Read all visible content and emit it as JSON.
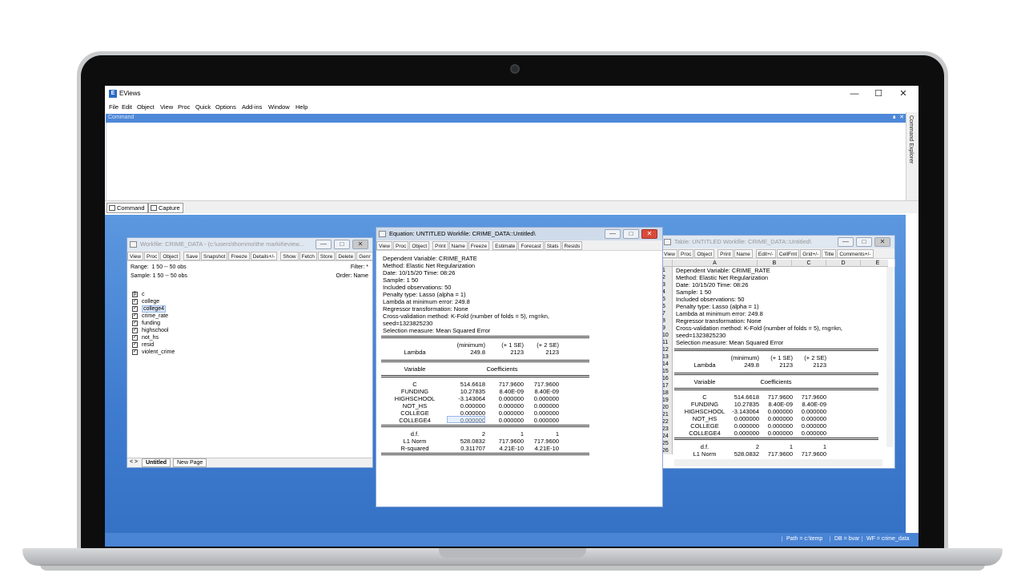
{
  "app": {
    "title": "EViews",
    "icon": "eviews-logo-icon"
  },
  "menu": [
    "File",
    "Edit",
    "Object",
    "View",
    "Proc",
    "Quick",
    "Options",
    "Add-ins",
    "Window",
    "Help"
  ],
  "command": {
    "label": "Command",
    "explorer": "Command Explorer"
  },
  "bottom_tabs": {
    "command": "Command",
    "capture": "Capture"
  },
  "status": {
    "path": "Path = c:\\temp",
    "db": "DB = bvar",
    "wf": "WF = crime_data"
  },
  "workfile": {
    "title": "Workfile: CRIME_DATA - (c:\\users\\thommo\\the markit\\eview...",
    "toolbar": [
      "View",
      "Proc",
      "Object",
      "Save",
      "Snapshot",
      "Freeze",
      "Details+/-",
      "Show",
      "Fetch",
      "Store",
      "Delete",
      "Genr",
      "Sample"
    ],
    "range_label": "Range:",
    "range_value": "1 50  --  50 obs",
    "filter": "Filter: *",
    "sample_label": "Sample:",
    "sample_value": "1 50  --  50 obs",
    "order": "Order: Name",
    "items": [
      {
        "name": "c",
        "icon": "coef-icon"
      },
      {
        "name": "college",
        "icon": "series-icon"
      },
      {
        "name": "college4",
        "icon": "series-icon"
      },
      {
        "name": "crime_rate",
        "icon": "series-icon"
      },
      {
        "name": "funding",
        "icon": "series-icon"
      },
      {
        "name": "highschool",
        "icon": "series-icon"
      },
      {
        "name": "not_hs",
        "icon": "series-icon"
      },
      {
        "name": "resid",
        "icon": "series-icon"
      },
      {
        "name": "violent_crime",
        "icon": "series-icon"
      }
    ],
    "tabs": {
      "nav": "< >",
      "untitled": "Untitled",
      "new_page": "New Page"
    }
  },
  "equation": {
    "title": "Equation: UNTITLED   Workfile: CRIME_DATA::Untitled\\",
    "toolbar": [
      "View",
      "Proc",
      "Object",
      "Print",
      "Name",
      "Freeze",
      "Estimate",
      "Forecast",
      "Stats",
      "Resids"
    ],
    "header_lines": [
      "Dependent Variable: CRIME_RATE",
      "Method: Elastic Net Regularization",
      "Date: 10/15/20   Time: 08:26",
      "Sample: 1 50",
      "Included observations: 50",
      "Penalty type: Lasso (alpha = 1)",
      "Lambda at minimum error: 249.8",
      "Regressor transformation: None",
      "Cross-validation method: K-Fold (number of folds = 5), rng=kn,",
      "      seed=1323825230",
      "Selection measure: Mean Squared Error"
    ],
    "lambda_cols": [
      "(minimum)",
      "(+ 1 SE)",
      "(+ 2 SE)"
    ],
    "lambda_row": {
      "label": "Lambda",
      "values": [
        "249.8",
        "2123",
        "2123"
      ]
    },
    "coef_header": {
      "variable": "Variable",
      "coefficients": "Coefficients"
    },
    "coef_rows": [
      {
        "name": "C",
        "values": [
          "514.6618",
          "717.9600",
          "717.9600"
        ]
      },
      {
        "name": "FUNDING",
        "values": [
          "10.27835",
          "8.40E-09",
          "8.40E-09"
        ]
      },
      {
        "name": "HIGHSCHOOL",
        "values": [
          "-3.143064",
          "0.000000",
          "0.000000"
        ]
      },
      {
        "name": "NOT_HS",
        "values": [
          "0.000000",
          "0.000000",
          "0.000000"
        ]
      },
      {
        "name": "COLLEGE",
        "values": [
          "0.000000",
          "0.000000",
          "0.000000"
        ]
      },
      {
        "name": "COLLEGE4",
        "values": [
          "0.000000",
          "0.000000",
          "0.000000"
        ]
      }
    ],
    "stat_rows": [
      {
        "name": "d.f.",
        "values": [
          "2",
          "1",
          "1"
        ]
      },
      {
        "name": "L1 Norm",
        "values": [
          "528.0832",
          "717.9600",
          "717.9600"
        ]
      },
      {
        "name": "R-squared",
        "values": [
          "0.311707",
          "4.21E-10",
          "4.21E-10"
        ]
      }
    ]
  },
  "table": {
    "title": "Table: UNTITLED   Workfile: CRIME_DATA::Untitled\\",
    "toolbar": [
      "View",
      "Proc",
      "Object",
      "Print",
      "Name",
      "Edit+/-",
      "CellFmt",
      "Grid+/-",
      "Title",
      "Comments+/-"
    ],
    "columns": [
      "A",
      "B",
      "C",
      "D",
      "E"
    ],
    "header_lines": [
      "Dependent Variable: CRIME_RATE",
      "Method: Elastic Net Regularization",
      "Date: 10/15/20   Time: 08:26",
      "Sample: 1 50",
      "Included observations: 50",
      "Penalty type: Lasso (alpha = 1)",
      "Lambda at minimum error: 249.8",
      "Regressor transformation: None",
      "Cross-validation method: K-Fold (number of folds = 5), rng=kn,",
      "      seed=1323825230",
      "Selection measure: Mean Squared Error"
    ],
    "row_numbers": [
      "1",
      "2",
      "3",
      "4",
      "5",
      "6",
      "7",
      "8",
      "9",
      "10",
      "11",
      "12",
      "13",
      "14",
      "15",
      "16",
      "17",
      "18",
      "19",
      "20",
      "21",
      "22",
      "23",
      "24",
      "25",
      "26"
    ],
    "lambda_cols": [
      "(minimum)",
      "(+ 1 SE)",
      "(+ 2 SE)"
    ],
    "lambda_row": {
      "label": "Lambda",
      "values": [
        "249.8",
        "2123",
        "2123"
      ]
    },
    "coef_header": {
      "variable": "Variable",
      "coefficients": "Coefficients"
    },
    "coef_rows": [
      {
        "name": "C",
        "values": [
          "514.6618",
          "717.9600",
          "717.9600"
        ]
      },
      {
        "name": "FUNDING",
        "values": [
          "10.27835",
          "8.40E-09",
          "8.40E-09"
        ]
      },
      {
        "name": "HIGHSCHOOL",
        "values": [
          "-3.143064",
          "0.000000",
          "0.000000"
        ]
      },
      {
        "name": "NOT_HS",
        "values": [
          "0.000000",
          "0.000000",
          "0.000000"
        ]
      },
      {
        "name": "COLLEGE",
        "values": [
          "0.000000",
          "0.000000",
          "0.000000"
        ]
      },
      {
        "name": "COLLEGE4",
        "values": [
          "0.000000",
          "0.000000",
          "0.000000"
        ]
      }
    ],
    "stat_rows": [
      {
        "name": "d.f.",
        "values": [
          "2",
          "1",
          "1"
        ]
      },
      {
        "name": "L1 Norm",
        "values": [
          "528.0832",
          "717.9600",
          "717.9600"
        ]
      }
    ]
  },
  "colors": {
    "accent": "#4e88d8",
    "desktop": "#3f7ccf",
    "close": "#d94a3a"
  }
}
